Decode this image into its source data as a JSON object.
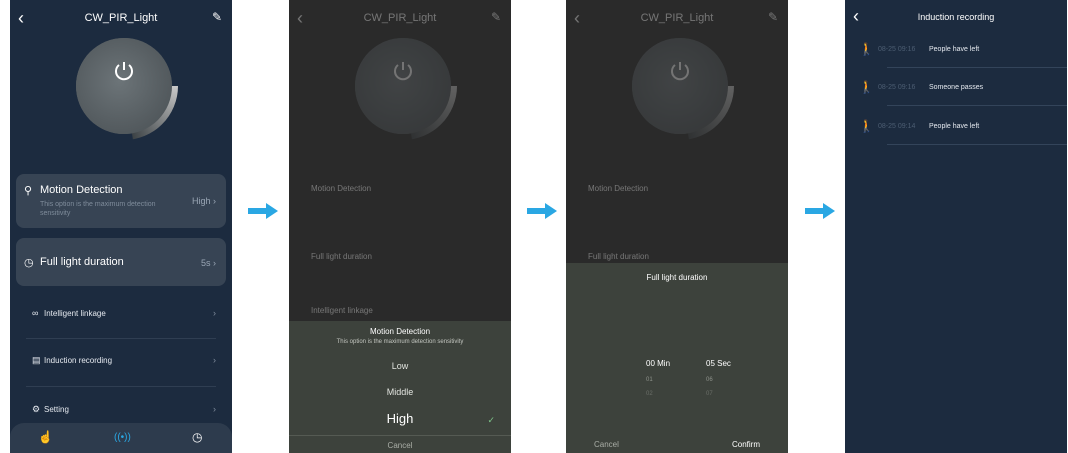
{
  "screen1": {
    "title": "CW_PIR_Light",
    "motion": {
      "label": "Motion Detection",
      "value": "High",
      "desc": "This option is the maximum detection sensitivity"
    },
    "duration": {
      "label": "Full light duration",
      "value": "5s"
    },
    "menu": [
      {
        "label": "Intelligent linkage",
        "icon": "link-icon"
      },
      {
        "label": "Induction recording",
        "icon": "document-icon"
      },
      {
        "label": "Setting",
        "icon": "gear-icon"
      }
    ],
    "tabs": [
      "hand-icon",
      "signal-icon",
      "clock-icon"
    ]
  },
  "screen2": {
    "title": "CW_PIR_Light",
    "bg_motion_label": "Motion Detection",
    "bg_duration_label": "Full light duration",
    "bg_linkage_label": "Intelligent linkage",
    "sheet_title": "Motion Detection",
    "sheet_subtitle": "This option is the maximum detection sensitivity",
    "options": [
      "Low",
      "Middle",
      "High"
    ],
    "selected": "High",
    "cancel": "Cancel"
  },
  "screen3": {
    "title": "CW_PIR_Light",
    "bg_motion_label": "Motion Detection",
    "bg_duration_label": "Full light duration",
    "sheet_title": "Full light duration",
    "min_value": "00",
    "min_unit": "Min",
    "sec_value": "05",
    "sec_unit": "Sec",
    "min_next": [
      "01",
      "02"
    ],
    "sec_next": [
      "06",
      "07"
    ],
    "cancel": "Cancel",
    "confirm": "Confirm"
  },
  "screen4": {
    "title": "Induction recording",
    "records": [
      {
        "time": "08-25 09:16",
        "text": "People have left"
      },
      {
        "time": "08-25 09:16",
        "text": "Someone passes"
      },
      {
        "time": "08-25 09:14",
        "text": "People have left"
      }
    ]
  },
  "colors": {
    "accent": "#2aa7e3",
    "app_bg": "#1c2b3f",
    "card": "#374454",
    "sheet": "#3d423c"
  }
}
